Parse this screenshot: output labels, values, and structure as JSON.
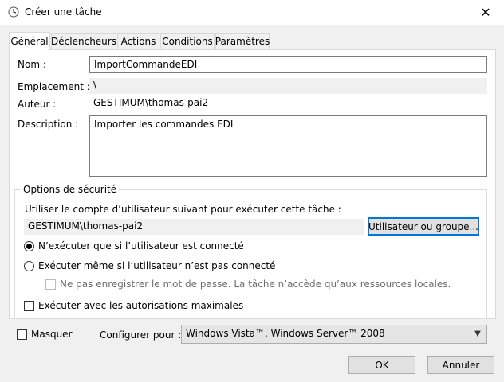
{
  "window": {
    "title": "Créer une tâche",
    "close_glyph": "✕",
    "icon": "clock-icon"
  },
  "tabs": [
    {
      "label": "Général",
      "active": true
    },
    {
      "label": "Déclencheurs",
      "active": false
    },
    {
      "label": "Actions",
      "active": false
    },
    {
      "label": "Conditions",
      "active": false
    },
    {
      "label": "Paramètres",
      "active": false
    }
  ],
  "general": {
    "name_label": "Nom :",
    "name_value": "ImportCommandeEDI",
    "location_label": "Emplacement :",
    "location_value": "\\",
    "author_label": "Auteur :",
    "author_value": "GESTIMUM\\thomas-pai2",
    "description_label": "Description :",
    "description_value": "Importer les commandes EDI"
  },
  "security": {
    "legend": "Options de sécurité",
    "account_prompt": "Utiliser le compte d’utilisateur suivant pour exécuter cette tâche :",
    "account_value": "GESTIMUM\\thomas-pai2",
    "user_group_button": "Utilisateur ou groupe...",
    "radio_connected": "N’exécuter que si l’utilisateur est connecté",
    "radio_always": "Exécuter même si l’utilisateur n’est pas connecté",
    "no_store_password": "Ne pas enregistrer le mot de passe. La tâche n’accède qu’aux ressources locales.",
    "highest_privileges": "Exécuter avec les autorisations maximales",
    "radio_connected_selected": true
  },
  "footer": {
    "hidden_label": "Masquer",
    "configure_label": "Configurer pour :",
    "configure_value": "Windows Vista™, Windows Server™ 2008",
    "ok_label": "OK",
    "cancel_label": "Annuler"
  },
  "colors": {
    "focus_blue": "#0078d7",
    "button_face": "#e1e1e1",
    "dialog_bg": "#f0f0f0"
  }
}
